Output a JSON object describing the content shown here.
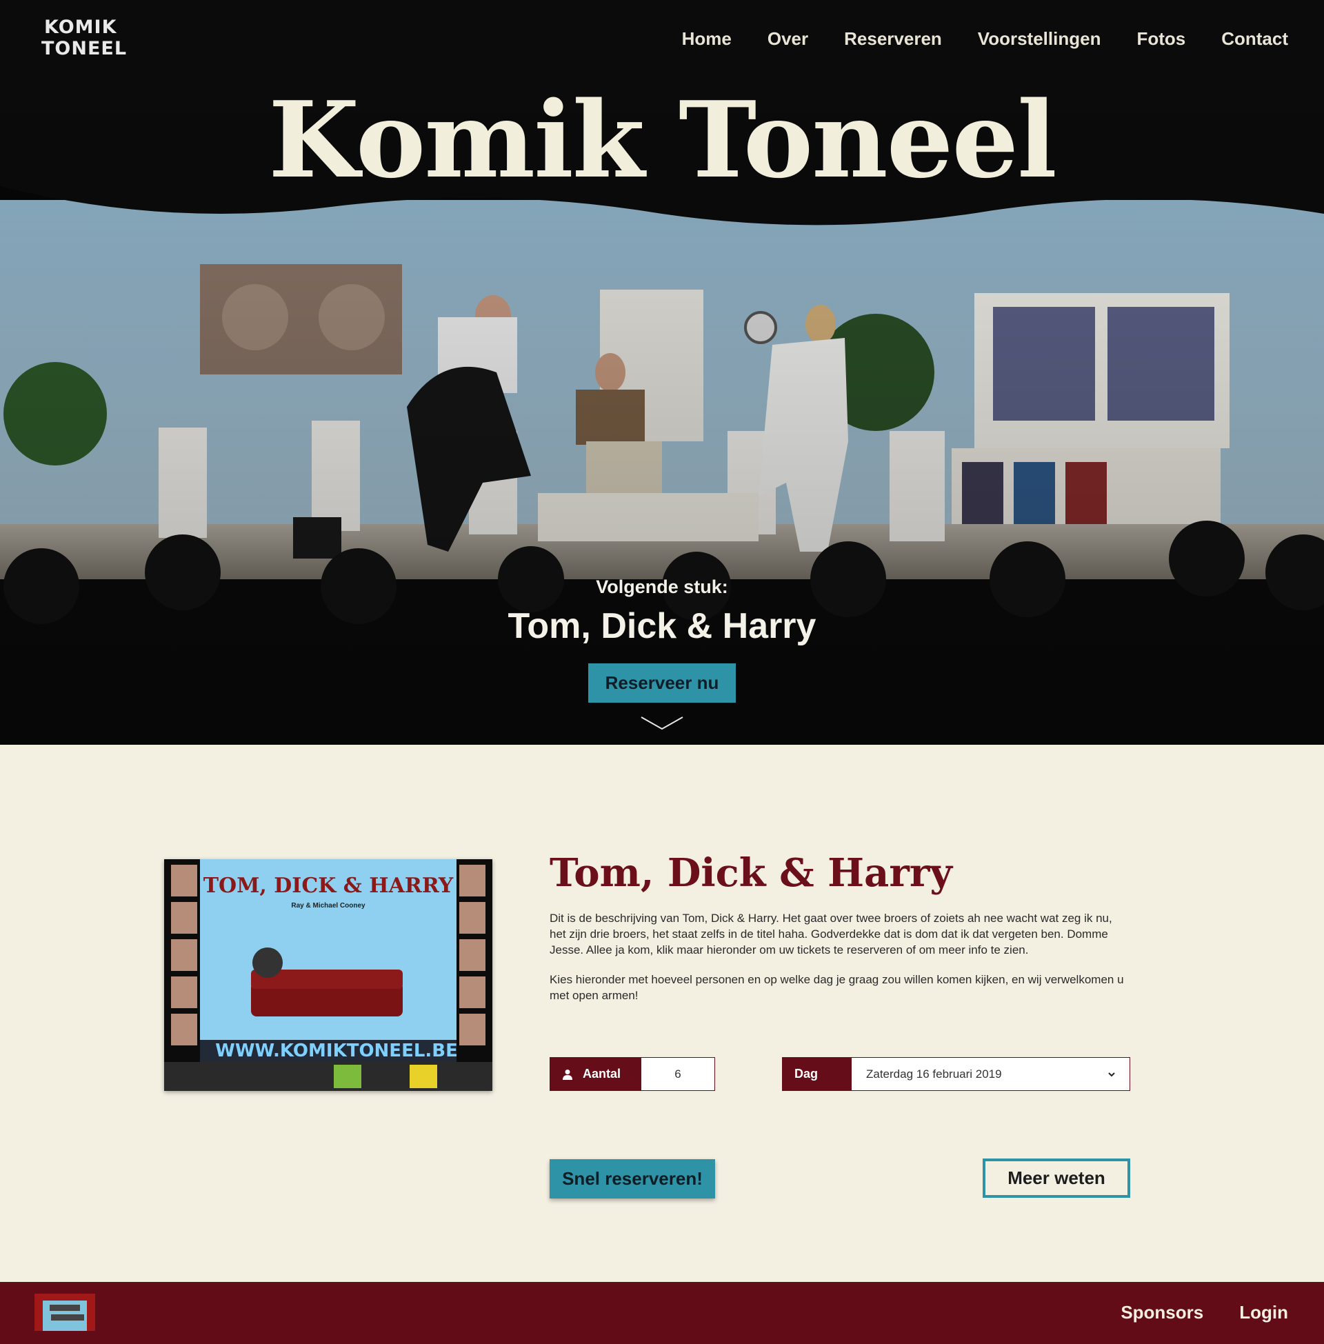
{
  "header": {
    "logo": {
      "line1": "KOMIK",
      "line2": "TONEEL"
    },
    "nav": [
      {
        "label": "Home"
      },
      {
        "label": "Over"
      },
      {
        "label": "Reserveren"
      },
      {
        "label": "Voorstellingen"
      },
      {
        "label": "Fotos"
      },
      {
        "label": "Contact"
      }
    ]
  },
  "hero": {
    "title": "Komik Toneel",
    "next_label": "Volgende stuk:",
    "next_title": "Tom, Dick & Harry",
    "cta_label": "Reserveer nu",
    "scroll_icon": "chevron-down-icon"
  },
  "show": {
    "poster": {
      "title": "TOM, DICK & HARRY",
      "authors": "Ray & Michael Cooney",
      "website": "WWW.KOMIKTONEEL.BE"
    },
    "title": "Tom, Dick & Harry",
    "description": [
      "Dit is de beschrijving van Tom, Dick & Harry. Het gaat over twee broers of zoiets ah nee wacht wat zeg ik nu, het zijn drie broers, het staat zelfs in de titel haha. Godverdekke dat is dom dat ik dat vergeten ben. Domme Jesse. Allee ja kom, klik maar hieronder om uw tickets te reserveren of om meer info te zien.",
      "Kies hieronder met hoeveel personen en op welke dag je graag zou willen komen kijken, en wij verwelkomen u met open armen!"
    ],
    "amount": {
      "label": "Aantal",
      "value": "6",
      "icon": "user-icon"
    },
    "day": {
      "label": "Dag",
      "selected": "Zaterdag 16 februari 2019"
    },
    "quick_reserve_label": "Snel reserveren!",
    "more_info_label": "Meer weten"
  },
  "footer": {
    "nav": [
      {
        "label": "Sponsors"
      },
      {
        "label": "Login"
      }
    ]
  },
  "colors": {
    "accent": "#2f93a8",
    "brand": "#650e1a",
    "background": "#f3f0e2",
    "hero_text": "#f1eedb"
  }
}
